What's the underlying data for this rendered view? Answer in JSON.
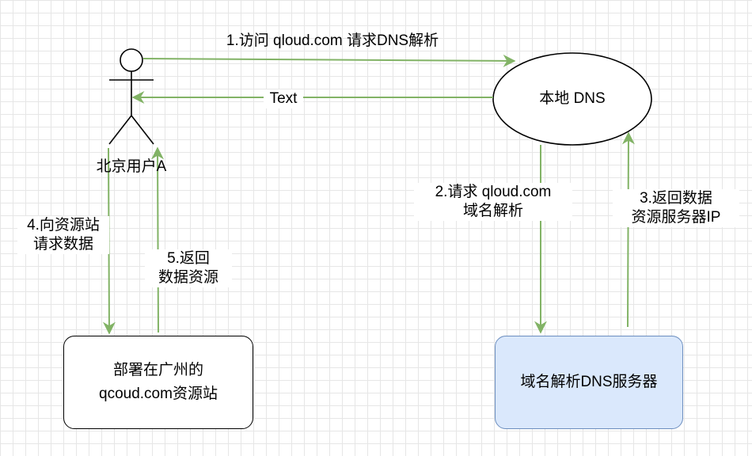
{
  "nodes": {
    "user": {
      "label": "北京用户A"
    },
    "local_dns": {
      "label": "本地 DNS"
    },
    "dns_server": {
      "label": "域名解析DNS服务器"
    },
    "resource_site": {
      "line1": "部署在广州的",
      "line2": "qcoud.com资源站"
    }
  },
  "edges": {
    "e1": {
      "label": "1.访问 qloud.com 请求DNS解析"
    },
    "return_text": {
      "label": "Text"
    },
    "e2": {
      "line1": "2.请求 qloud.com",
      "line2": "域名解析"
    },
    "e3": {
      "line1": "3.返回数据",
      "line2": "资源服务器IP"
    },
    "e4": {
      "line1": "4.向资源站",
      "line2": "请求数据"
    },
    "e5": {
      "line1": "5.返回",
      "line2": "数据资源"
    }
  },
  "colors": {
    "edge": "#82b366",
    "dns_server_fill": "#dae8fc",
    "dns_server_stroke": "#6c8ebf",
    "stroke": "#000000"
  }
}
